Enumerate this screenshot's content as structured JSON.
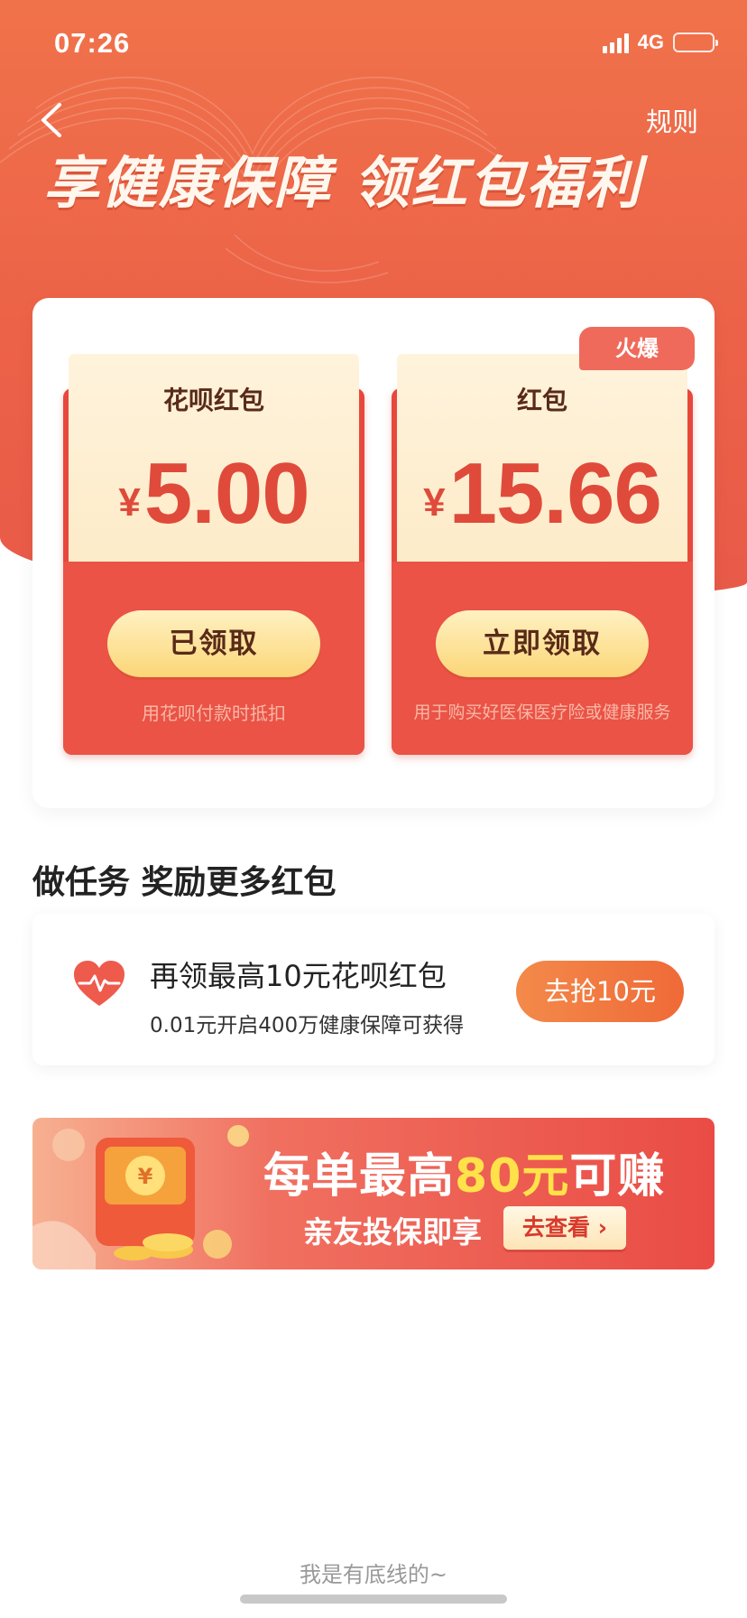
{
  "status_bar": {
    "time": "07:26",
    "network": "4G"
  },
  "nav": {
    "rules_label": "规则"
  },
  "hero": {
    "title": "享健康保障 领红包福利"
  },
  "envelopes": [
    {
      "name": "花呗红包",
      "currency": "¥",
      "amount": "5.00",
      "button_label": "已领取",
      "note": "用花呗付款时抵扣"
    },
    {
      "name": "红包",
      "currency": "¥",
      "amount": "15.66",
      "button_label": "立即领取",
      "note": "用于购买好医保医疗险或健康服务",
      "badge": "火爆"
    }
  ],
  "tasks": {
    "section_title": "做任务 奖励更多红包",
    "items": [
      {
        "title": "再领最高10元花呗红包",
        "subtitle": "0.01元开启400万健康保障可获得",
        "button_label": "去抢10元"
      }
    ]
  },
  "banner": {
    "line1_prefix": "每单最高",
    "line1_highlight": "80元",
    "line1_suffix": "可赚",
    "line2": "亲友投保即享",
    "button_label": "去查看 ›"
  },
  "footer": {
    "text": "我是有底线的~"
  },
  "colors": {
    "primary": "#ec6248",
    "envelope_red": "#e8483c",
    "gold": "#fbd677",
    "amount_red": "#e04a3a"
  },
  "icons": [
    "back-arrow-icon",
    "heart-pulse-icon",
    "signal-icon",
    "battery-icon",
    "red-packet-illustration"
  ]
}
